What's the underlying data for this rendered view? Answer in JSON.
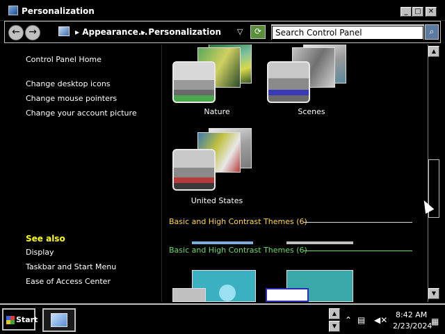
{
  "window": {
    "title": "Personalization",
    "min_glyph": "_",
    "max_glyph": "□",
    "close_glyph": "✕"
  },
  "address": {
    "back_glyph": "←",
    "forward_glyph": "→",
    "crumb_1": "▸ Appearance...",
    "crumb_2": "▸ Personalization",
    "dropdown_glyph": "▽",
    "refresh_glyph": "⟳",
    "search_placeholder": "Search Control Panel",
    "search_value": "Search Control Panel",
    "search_glyph": "⌕"
  },
  "sidebar": {
    "home": "Control Panel Home",
    "links": [
      "Change desktop icons",
      "Change mouse pointers",
      "Change your account picture"
    ],
    "see_also_title": "See also",
    "see_also": [
      "Display",
      "Taskbar and Start Menu",
      "Ease of Access Center"
    ]
  },
  "themes": [
    {
      "name": "Nature",
      "accent": "#4aa84a"
    },
    {
      "name": "Scenes",
      "accent": "#3a3ab8"
    },
    {
      "name": "United States",
      "accent": "#b83a3a"
    }
  ],
  "sections": {
    "basic_header": "Basic and High Contrast Themes (6)",
    "basic_header_overlay": "Basic and High Contrast Themes (6)"
  },
  "scrollbar": {
    "up_glyph": "▲",
    "down_glyph": "▼"
  },
  "taskbar": {
    "start_label": "Start",
    "time": "8:42 AM",
    "date": "2/23/2024",
    "tray_icons": [
      "chevron-up-icon",
      "network-icon",
      "speaker-muted-icon",
      "action-center-icon"
    ]
  },
  "colors": {
    "accent_yellow": "#ffd84a",
    "accent_green": "#6ddc6d",
    "see_also": "#ffff00"
  }
}
